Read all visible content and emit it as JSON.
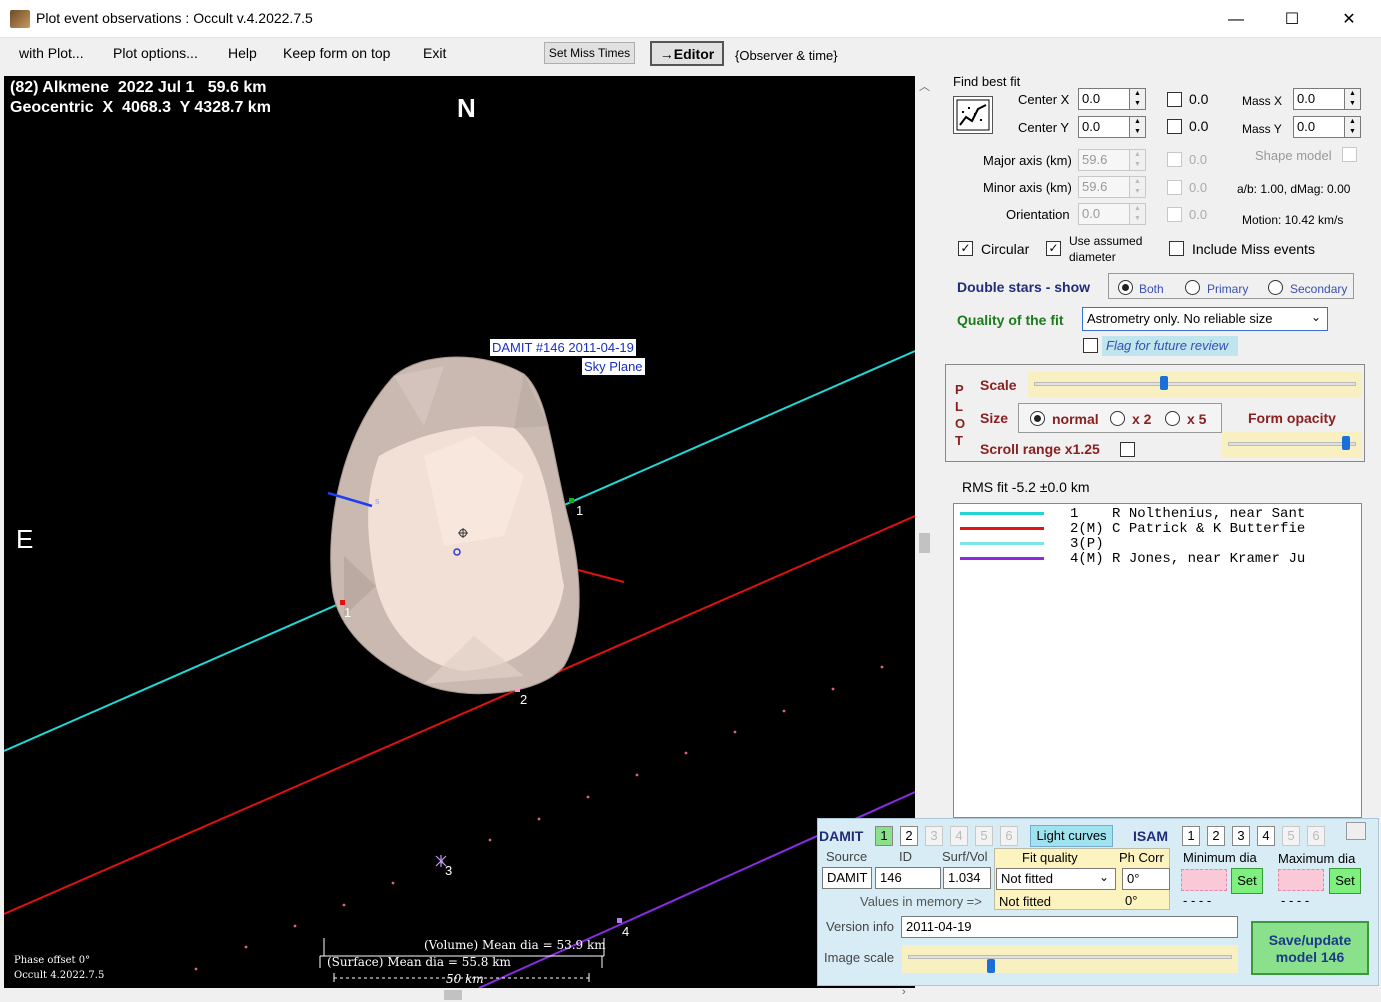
{
  "window": {
    "title": "Plot event observations : Occult v.4.2022.7.5",
    "minimize": "—",
    "maximize": "☐",
    "close": "✕"
  },
  "menu": {
    "items": [
      "with Plot...",
      "Plot options...",
      "Help",
      "Keep form on top",
      "Exit"
    ],
    "set_miss_times": "Set Miss Times",
    "editor": "→Editor",
    "observer_time": "{Observer & time}"
  },
  "plot": {
    "header_line1": "(82) Alkmene  2022 Jul 1   59.6 km",
    "header_line2": "Geocentric  X  4068.3  Y 4328.7 km",
    "north": "N",
    "east": "E",
    "damit_label": "DAMIT #146 2011-04-19",
    "sky_plane": "Sky Plane",
    "chord_labels": [
      "1",
      "1",
      "2",
      "3",
      "4"
    ],
    "phase_offset": "Phase offset 0°",
    "version": "Occult 4.2022.7.5",
    "volume_mean": "(Volume) Mean dia = 53.9 km",
    "surface_mean": "(Surface) Mean dia = 55.8 km",
    "scale_bar": "50 km"
  },
  "fit": {
    "find_best_fit": "Find best fit",
    "center_x_label": "Center X",
    "center_x": "0.0",
    "center_y_label": "Center Y",
    "center_y": "0.0",
    "mass_x_label": "Mass X",
    "mass_x": "0.0",
    "mass_y_label": "Mass Y",
    "mass_y": "0.0",
    "chk_x_val": "0.0",
    "chk_y_val": "0.0",
    "major_label": "Major axis (km)",
    "major": "59.6",
    "minor_label": "Minor axis (km)",
    "minor": "59.6",
    "orient_label": "Orientation",
    "orient": "0.0",
    "chk_major_val": "0.0",
    "chk_minor_val": "0.0",
    "chk_orient_val": "0.0",
    "shape_model": "Shape model",
    "ab": "a/b: 1.00, dMag: 0.00",
    "motion": "Motion: 10.42 km/s",
    "circular": "Circular",
    "use_assumed_1": "Use assumed",
    "use_assumed_2": "diameter",
    "include_miss": "Include Miss events",
    "double_stars": "Double stars - show",
    "both": "Both",
    "primary": "Primary",
    "secondary": "Secondary",
    "quality_label": "Quality of the fit",
    "quality_value": "Astrometry only. No reliable size",
    "flag_review": "Flag for future review"
  },
  "plotopts": {
    "letters": [
      "P",
      "L",
      "O",
      "T"
    ],
    "scale": "Scale",
    "size": "Size",
    "normal": "normal",
    "x2": "x 2",
    "x5": "x 5",
    "form_opacity": "Form opacity",
    "scroll_range": "Scroll range x1.25",
    "scale_pct": 0.4,
    "opacity_pct": 0.95
  },
  "rms": "RMS fit -5.2 ±0.0 km",
  "legend": {
    "rows": [
      {
        "num": "1   ",
        "text": "R Nolthenius, near Sant",
        "color": "#22d6d6"
      },
      {
        "num": "2(M)",
        "text": "C Patrick & K Butterfie",
        "color": "#e01515"
      },
      {
        "num": "3(P)",
        "text": "",
        "color": "#7ee6e0"
      },
      {
        "num": "4(M)",
        "text": "R Jones, near Kramer Ju",
        "color": "#8a2be2"
      }
    ]
  },
  "damit": {
    "damit": "DAMIT",
    "damit_nums": [
      "1",
      "2",
      "3",
      "4",
      "5",
      "6"
    ],
    "light_curves": "Light curves",
    "isam": "ISAM",
    "isam_nums": [
      "1",
      "2",
      "3",
      "4",
      "5",
      "6"
    ],
    "source_label": "Source",
    "id_label": "ID",
    "surfvol_label": "Surf/Vol",
    "fit_quality_label": "Fit quality",
    "ph_corr_label": "Ph Corr",
    "min_dia_label": "Minimum dia",
    "max_dia_label": "Maximum dia",
    "source": "DAMIT",
    "id": "146",
    "surfvol": "1.034",
    "fit_quality": "Not fitted",
    "ph_corr": "0°",
    "set": "Set",
    "values_in_memory": "Values in memory =>",
    "mem_fit": "Not fitted",
    "mem_ph": "0°",
    "mem_min": "- - - -",
    "mem_max": "- - - -",
    "version_label": "Version info",
    "version": "2011-04-19",
    "image_scale": "Image scale",
    "save_1": "Save/update",
    "save_2": "model  146",
    "image_scale_pct": 0.25
  }
}
